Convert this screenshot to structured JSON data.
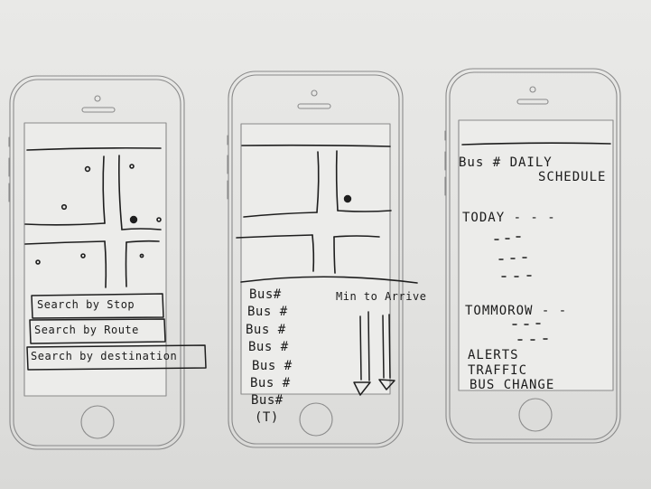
{
  "phone1": {
    "buttons": [
      "Search by Stop",
      "Search by Route",
      "Search by destination"
    ]
  },
  "phone2": {
    "bus_list": [
      "Bus#",
      "Bus #",
      "Bus #",
      "Bus #",
      "Bus #",
      "Bus #",
      "Bus#",
      "(T)"
    ],
    "column_header": "Min to Arrive"
  },
  "phone3": {
    "title_line1": "Bus # DAILY",
    "title_line2": "SCHEDULE",
    "today_label": "TODAY - - -",
    "tomorrow_label": "TOMMOROW - -",
    "alerts_line1": "ALERTS",
    "alerts_line2": "TRAFFIC",
    "alerts_line3": "BUS CHANGE"
  }
}
